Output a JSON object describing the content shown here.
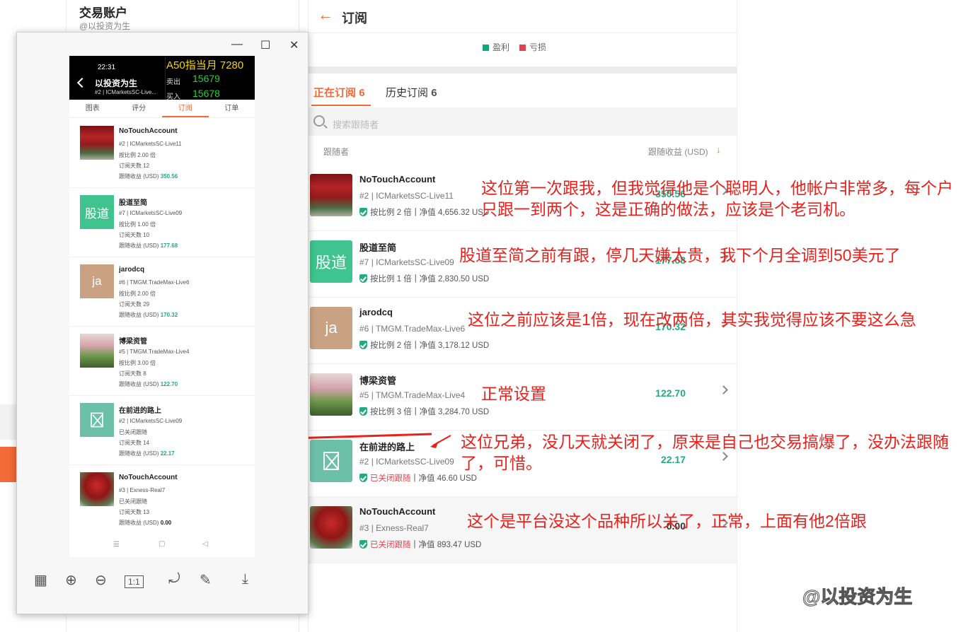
{
  "background": {
    "account_title": "交易账户",
    "account_handle": "@以投资为生"
  },
  "main": {
    "title": "订阅",
    "legend": [
      {
        "label": "盈利",
        "color": "#14a57a"
      },
      {
        "label": "亏损",
        "color": "#e0434f"
      }
    ],
    "tabs": {
      "active": "正在订阅",
      "active_count": "6",
      "history": "历史订阅",
      "history_count": "6"
    },
    "search_placeholder": "搜索跟随者",
    "col_follower": "跟随者",
    "col_profit": "跟随收益 (USD)",
    "sort_icon": "↓",
    "rows": [
      {
        "name": "NoTouchAccount",
        "num": "#2",
        "server": "ICMarketsSC-Live11",
        "ratio": "按比例 2 倍",
        "equity": "净值 4,656.32 USD",
        "profit": "350.56"
      },
      {
        "name": "股道至简",
        "avatar": "股道",
        "num": "#7",
        "server": "ICMarketsSC-Live09",
        "ratio": "按比例 1 倍",
        "equity": "净值 2,830.50 USD",
        "profit": "177.68"
      },
      {
        "name": "jarodcq",
        "avatar": "ja",
        "num": "#6",
        "server": "TMGM.TradeMax-Live6",
        "ratio": "按比例 2 倍",
        "equity": "净值 3,178.12 USD",
        "profit": "170.32"
      },
      {
        "name": "博梁资管",
        "num": "#5",
        "server": "TMGM.TradeMax-Live4",
        "ratio": "按比例 3 倍",
        "equity": "净值 3,284.70 USD",
        "profit": "122.70"
      },
      {
        "name": "在前进的路上",
        "num": "#2",
        "server": "ICMarketsSC-Live09",
        "ratio": "已关闭跟随",
        "equity": "净值 46.60 USD",
        "profit": "22.17"
      },
      {
        "name": "NoTouchAccount",
        "num": "#3",
        "server": "Exness-Real7",
        "ratio": "已关闭跟随",
        "equity": "净值 893.47 USD",
        "profit": "0.00"
      }
    ]
  },
  "annotations": [
    "这位第一次跟我，但我觉得他是个聪明人，他帐户非常多，每个户只跟一到两个，这是正确的做法，应该是个老司机。",
    "股道至简之前有跟，停几天嫌太贵，我下个月全调到50美元了",
    "这位之前应该是1倍，现在改两倍，其实我觉得应该不要这么急",
    "正常设置",
    "这位兄弟，没几天就关闭了，原来是自己也交易搞爆了，没办法跟随了，可惜。",
    "这个是平台没这个品种所以关了，正常，上面有他2倍跟"
  ],
  "watermark": "@以投资为生",
  "phone": {
    "time": "22:31",
    "title": "以投资为生",
    "subtitle": "#2 | ICMarketsSC-Live...",
    "ticker": {
      "name": "A50指当月",
      "price": "7280",
      "sell_label": "卖出",
      "sell": "15679",
      "buy_label": "买入",
      "buy": "15678"
    },
    "tabs": [
      "图表",
      "评分",
      "订阅",
      "订单"
    ],
    "rows": [
      {
        "name": "NoTouchAccount",
        "line1": "#2 | ICMarketsSC-Live11",
        "ratio": "按比例 2.00 倍",
        "days": "订阅天数 12",
        "profit_label": "跟随收益 (USD)",
        "profit": "350.56"
      },
      {
        "name": "股道至简",
        "avatar": "股道",
        "line1": "#7 | ICMarketsSC-Live09",
        "ratio": "按比例 1.00 倍",
        "days": "订阅天数 10",
        "profit_label": "跟随收益 (USD)",
        "profit": "177.68"
      },
      {
        "name": "jarodcq",
        "avatar": "ja",
        "line1": "#6 | TMGM.TradeMax-Live6",
        "ratio": "按比例 2.00 倍",
        "days": "订阅天数 29",
        "profit_label": "跟随收益 (USD)",
        "profit": "170.32"
      },
      {
        "name": "博梁资管",
        "line1": "#5 | TMGM.TradeMax-Live4",
        "ratio": "按比例 3.00 倍",
        "days": "订阅天数 8",
        "profit_label": "跟随收益 (USD)",
        "profit": "122.70"
      },
      {
        "name": "在前进的路上",
        "line1": "#2 | ICMarketsSC-Live09",
        "ratio": "已关闭跟随",
        "days": "订阅天数 14",
        "profit_label": "跟随收益 (USD)",
        "profit": "22.17"
      },
      {
        "name": "NoTouchAccount",
        "line1": "#3 | Exness-Real7",
        "ratio": "已关闭跟随",
        "days": "订阅天数 13",
        "profit_label": "跟随收益 (USD)",
        "profit": "0.00"
      }
    ]
  }
}
